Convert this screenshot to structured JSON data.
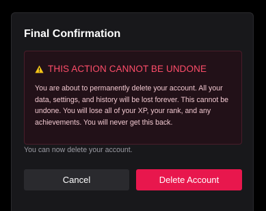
{
  "dialog": {
    "title": "Final Confirmation",
    "warning": {
      "icon": "warning-triangle-icon",
      "title": "THIS ACTION CANNOT BE UNDONE",
      "body": "You are about to permanently delete your account. All your data, settings, and history will be lost forever. This cannot be undone. You will lose all of your XP, your rank, and any achievements. You will never get this back."
    },
    "status": "You can now delete your account.",
    "buttons": {
      "cancel_label": "Cancel",
      "delete_label": "Delete Account"
    }
  },
  "colors": {
    "dialog_background": "#18181b",
    "warning_accent": "#ff4d6a",
    "delete_button": "#e8174d",
    "cancel_button": "#2a2a2e"
  }
}
